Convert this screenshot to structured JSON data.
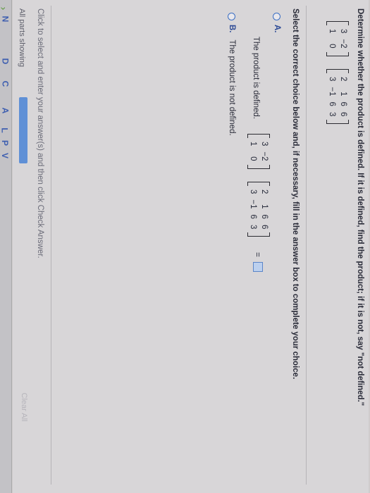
{
  "sidebar": {
    "letters": [
      "N",
      "D",
      "C",
      "A",
      "L",
      "P",
      "V"
    ]
  },
  "question": {
    "text": "Determine whether the product is defined. If it is defined, find the product; if it is not, say \"not defined.\"",
    "matrix_a": [
      [
        "3",
        "−2"
      ],
      [
        "1",
        "0"
      ]
    ],
    "matrix_b": [
      [
        "2",
        "1",
        "6",
        "6"
      ],
      [
        "3",
        "−1",
        "6",
        "3"
      ]
    ]
  },
  "instructions": "Select the correct choice below and, if necessary, fill in the answer box to complete your choice.",
  "choices": {
    "a": {
      "letter": "A.",
      "text": "The product is defined."
    },
    "b": {
      "letter": "B.",
      "text": "The product is not defined."
    },
    "equals": "="
  },
  "footer": {
    "note": "Click to select and enter your answer(s) and then click Check Answer.",
    "parts_label": "All parts showing",
    "clear_all": "Clear All"
  },
  "colors": {
    "accent": "#3b6fc4",
    "progress": "#5f90d6"
  }
}
